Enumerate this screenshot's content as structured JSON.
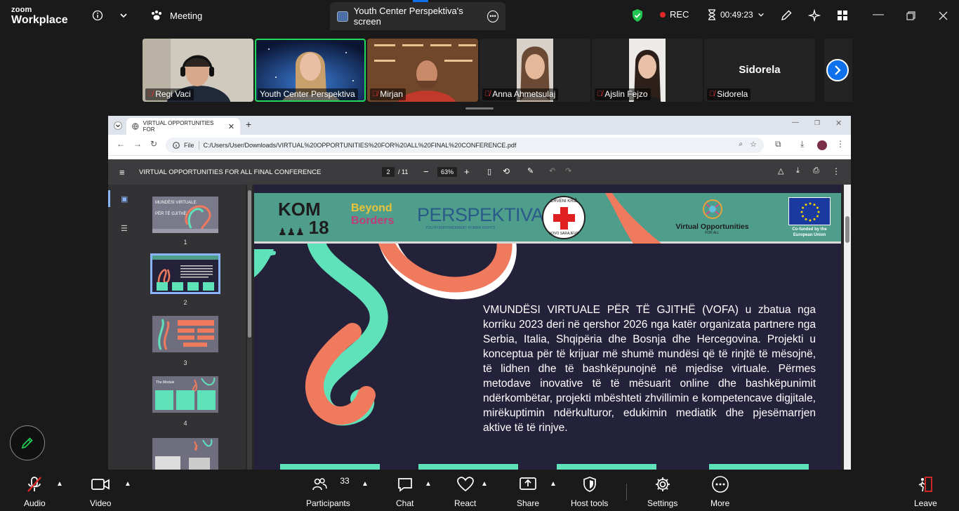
{
  "app": {
    "brand_small": "zoom",
    "brand_large": "Workplace"
  },
  "topbar": {
    "meeting_label": "Meeting",
    "share_tab_label": "Youth Center Perspektiva's screen",
    "rec_label": "REC",
    "timer": "00:49:23"
  },
  "participants": [
    {
      "name": "Regi Vaci",
      "muted": true
    },
    {
      "name": "Youth Center Perspektiva",
      "muted": false,
      "active": true
    },
    {
      "name": "Mirjan",
      "muted": true
    },
    {
      "name": "Anna Ahmetsulaj",
      "muted": true
    },
    {
      "name": "Ajslin Fejzo",
      "muted": true
    },
    {
      "name": "Sidorela",
      "muted": true,
      "video_off": true
    }
  ],
  "browser": {
    "tab_title": "VIRTUAL OPPORTUNITIES FOR",
    "url_prefix": "File",
    "url": "C:/Users/User/Downloads/VIRTUAL%20OPPORTUNITIES%20FOR%20ALL%20FINAL%20CONFERENCE.pdf"
  },
  "pdf": {
    "title": "VIRTUAL OPPORTUNITIES FOR ALL FINAL CONFERENCE",
    "page_current": "2",
    "page_total": "/ 11",
    "zoom": "63%",
    "thumbnails": [
      "1",
      "2",
      "3",
      "4"
    ],
    "selected_thumbnail": 2,
    "thumb1_title_a": "MUNDËSI VIRTUALE",
    "thumb1_title_b": "PËR TË GJITHË",
    "thumb4_title": "The Module"
  },
  "slide": {
    "logo_kom": "KOM",
    "logo_kom_num": "18",
    "logo_beyond": "Beyond",
    "logo_borders": "Borders",
    "logo_perspektiva": "PERSPEKTIVA",
    "logo_perspektiva_sub": "YOUTH EMPOWERMENT  HUMAN RIGHTS",
    "logo_redcross_top": "CRVENI KRIŽ",
    "logo_redcross_bottom": "NOVO SARAJEVO",
    "logo_vofa": "Virtual Opportunities",
    "logo_vofa_sub": "FOR ALL",
    "logo_eu": "Co-funded by the European Union",
    "paragraph": "VMUNDËSI VIRTUALE PËR TË GJITHË (VOFA) u zbatua nga korriku 2023 deri në qershor 2026 nga katër organizata partnere nga Serbia, Italia, Shqipëria dhe Bosnja dhe Hercegovina. Projekti u konceptua për të krijuar më shumë mundësi që të rinjtë të mësojnë, të lidhen dhe të bashkëpunojnë në mjedise virtuale. Përmes metodave inovative të të mësuarit online dhe bashkëpunimit ndërkombëtar, projekti mbështeti zhvillimin e kompetencave digjitale, mirëkuptimin ndërkulturor, edukimin mediatik dhe pjesëmarrjen aktive të të rinjve."
  },
  "controls": {
    "audio": "Audio",
    "video": "Video",
    "participants": "Participants",
    "participants_count": "33",
    "chat": "Chat",
    "react": "React",
    "share": "Share",
    "host_tools": "Host tools",
    "settings": "Settings",
    "more": "More",
    "leave": "Leave"
  },
  "colors": {
    "zoom_blue": "#0e71eb",
    "active_green": "#23d959",
    "banner_teal": "#4f9e8c",
    "slide_bg": "#23223a",
    "swirl_coral": "#f07a5e",
    "swirl_mint": "#5fe1b9"
  }
}
